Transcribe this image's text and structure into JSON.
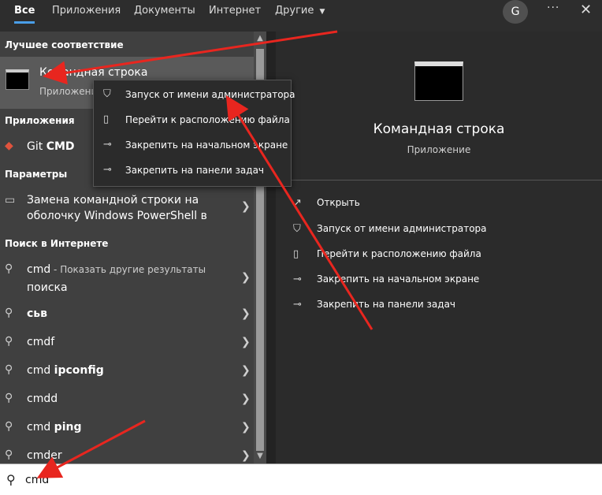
{
  "tabs": [
    "Все",
    "Приложения",
    "Документы",
    "Интернет",
    "Другие"
  ],
  "user_initial": "G",
  "more_label": "···",
  "close_label": "✕",
  "sections": {
    "best": "Лучшее соответствие",
    "apps": "Приложения",
    "settings": "Параметры",
    "web": "Поиск в Интернете"
  },
  "best_match": {
    "title": "Командная строка",
    "subtitle": "Приложение"
  },
  "apps": [
    {
      "prefix": "Git ",
      "bold": "CMD"
    }
  ],
  "settings_item": {
    "line1": "Замена командной строки на",
    "line2": "оболочку Windows PowerShell в"
  },
  "web_results": [
    {
      "plain": "cmd",
      "bold": "",
      "suffix": " - Показать другие результаты",
      "suffix2": "поиска"
    },
    {
      "plain": "",
      "bold": "сьв"
    },
    {
      "plain": "cmdf",
      "bold": ""
    },
    {
      "plain": "cmd ",
      "bold": "ipconfig"
    },
    {
      "plain": "cmdd",
      "bold": ""
    },
    {
      "plain": "cmd ",
      "bold": "ping"
    },
    {
      "plain": "cmder",
      "bold": ""
    }
  ],
  "context_menu": [
    "Запуск от имени администратора",
    "Перейти к расположению файла",
    "Закрепить на начальном экране",
    "Закрепить на панели задач"
  ],
  "right_panel": {
    "title": "Командная строка",
    "subtitle": "Приложение",
    "actions": [
      "Открыть",
      "Запуск от имени администратора",
      "Перейти к расположению файла",
      "Закрепить на начальном экране",
      "Закрепить на панели задач"
    ]
  },
  "search": {
    "value": "cmd"
  },
  "colors": {
    "accent": "#4a9ee8",
    "arrow": "#e8261f"
  }
}
